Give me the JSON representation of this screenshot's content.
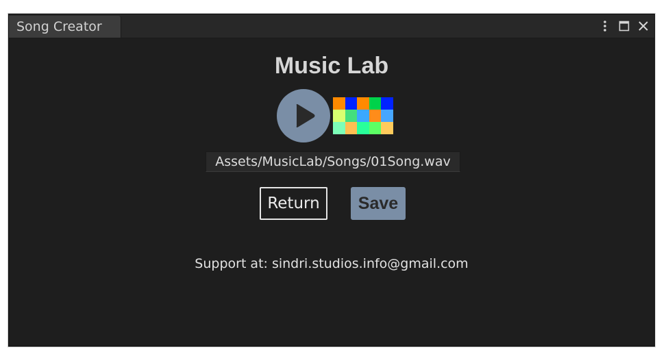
{
  "window": {
    "tab_label": "Song Creator",
    "icons": {
      "menu": "vertical-dots-icon",
      "maximize": "maximize-icon",
      "close": "close-icon"
    }
  },
  "main": {
    "title": "Music Lab",
    "play_icon": "play-icon",
    "thumbnail_colors": [
      "#ff8a00",
      "#0022ff",
      "#ff8a00",
      "#00d24a",
      "#0022ff",
      "#d8ff70",
      "#43df7e",
      "#3aa8ff",
      "#ff8c1a",
      "#46a6ff",
      "#7dffb8",
      "#ffbf52",
      "#29ff9a",
      "#5cff64",
      "#ffcb5c"
    ],
    "file_path": "Assets/MusicLab/Songs/01Song.wav",
    "return_label": "Return",
    "save_label": "Save",
    "support_text": "Support at: sindri.studios.info@gmail.com"
  },
  "colors": {
    "background": "#1e1e1e",
    "accent": "#7a8ea6"
  }
}
